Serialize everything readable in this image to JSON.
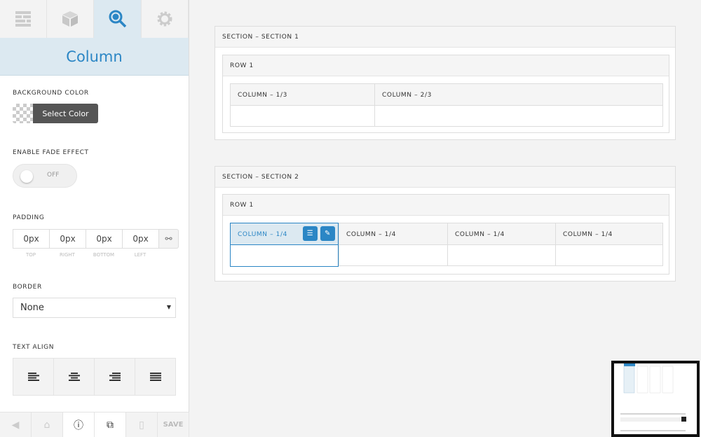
{
  "sidebar": {
    "tabs": [
      {
        "icon": "layout-icon"
      },
      {
        "icon": "box-icon"
      },
      {
        "icon": "search-icon",
        "active": true
      },
      {
        "icon": "gear-icon"
      }
    ],
    "title": "Column",
    "background_color": {
      "label": "BACKGROUND COLOR",
      "button": "Select Color"
    },
    "fade": {
      "label": "ENABLE FADE EFFECT",
      "state": "OFF"
    },
    "padding": {
      "label": "PADDING",
      "values": [
        "0px",
        "0px",
        "0px",
        "0px"
      ],
      "sublabels": [
        "TOP",
        "RIGHT",
        "BOTTOM",
        "LEFT"
      ]
    },
    "border": {
      "label": "BORDER",
      "value": "None"
    },
    "text_align": {
      "label": "TEXT ALIGN",
      "options": [
        "align-left-icon",
        "align-center-icon",
        "align-right-icon",
        "align-justify-icon"
      ]
    },
    "bottom_bar": {
      "save": "SAVE"
    }
  },
  "canvas": {
    "sections": [
      {
        "title": "SECTION – SECTION 1",
        "row": "ROW 1",
        "columns": [
          "COLUMN – 1/3",
          "COLUMN – 2/3"
        ]
      },
      {
        "title": "SECTION – SECTION 2",
        "row": "ROW 1",
        "columns": [
          "COLUMN – 1/4",
          "COLUMN – 1/4",
          "COLUMN – 1/4",
          "COLUMN – 1/4"
        ]
      }
    ]
  },
  "colors": {
    "accent": "#2b86c5",
    "accent_light": "#dce9f1"
  }
}
